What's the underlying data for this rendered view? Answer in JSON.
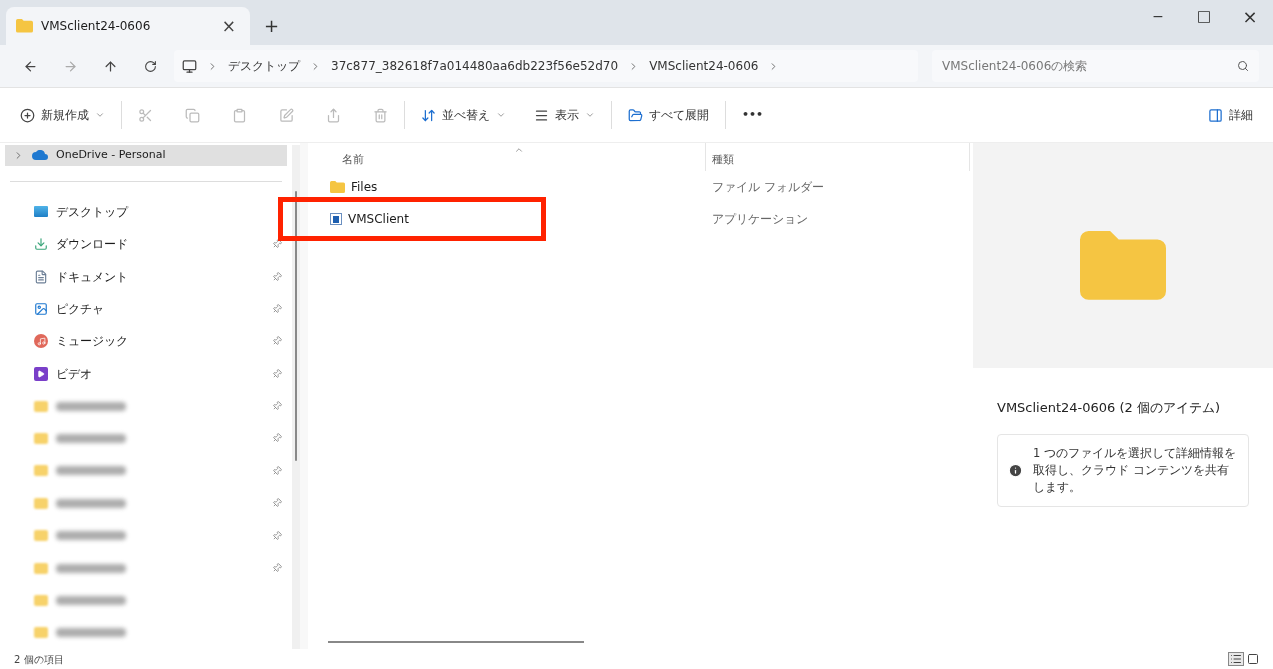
{
  "tab": {
    "title": "VMSclient24-0606",
    "close": "×",
    "new_tab": "+"
  },
  "window_controls": {
    "minimize": "−",
    "maximize": "□",
    "close": "×"
  },
  "breadcrumbs": [
    "デスクトップ",
    "37c877_382618f7a014480aa6db223f56e52d70",
    "VMSclient24-0606"
  ],
  "search": {
    "placeholder": "VMSclient24-0606の検索"
  },
  "toolbar": {
    "new": "新規作成",
    "sort": "並べ替え",
    "view": "表示",
    "expand": "すべて展開",
    "more": "•••",
    "details": "詳細"
  },
  "sidebar": {
    "onedrive": {
      "label": "OneDrive - Personal",
      "selected": true
    },
    "items": [
      {
        "kind": "desktop",
        "label": "デスクトップ",
        "pinned": false
      },
      {
        "kind": "download",
        "label": "ダウンロード",
        "pinned": true
      },
      {
        "kind": "document",
        "label": "ドキュメント",
        "pinned": true
      },
      {
        "kind": "picture",
        "label": "ピクチャ",
        "pinned": true
      },
      {
        "kind": "music",
        "label": "ミュージック",
        "pinned": true
      },
      {
        "kind": "video",
        "label": "ビデオ",
        "pinned": true
      },
      {
        "kind": "redacted",
        "pinned": true
      },
      {
        "kind": "redacted",
        "pinned": true
      },
      {
        "kind": "redacted",
        "pinned": true
      },
      {
        "kind": "redacted",
        "pinned": true
      },
      {
        "kind": "redacted",
        "pinned": true
      },
      {
        "kind": "redacted",
        "pinned": true
      },
      {
        "kind": "redacted",
        "pinned": false
      },
      {
        "kind": "redacted",
        "pinned": false
      }
    ]
  },
  "table": {
    "columns": [
      "名前",
      "種類"
    ],
    "rows": [
      {
        "kind": "folder",
        "name": "Files",
        "type": "ファイル フォルダー",
        "highlighted": false
      },
      {
        "kind": "app",
        "name": "VMSClient",
        "type": "アプリケーション",
        "highlighted": true
      }
    ]
  },
  "details": {
    "title": "VMSclient24-0606 (2 個のアイテム)",
    "info": "1 つのファイルを選択して詳細情報を取得し、クラウド コンテンツを共有します。"
  },
  "status_bar": "2 個の項目"
}
